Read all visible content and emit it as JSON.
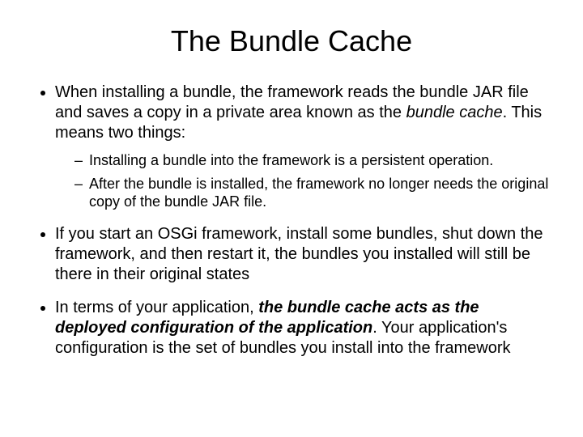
{
  "title": "The Bundle Cache",
  "bullets": {
    "b1_pre": "When installing a bundle, the framework reads the bundle JAR file and saves a copy in a private area known as the ",
    "b1_em": "bundle cache",
    "b1_post": ". This means two things:",
    "b1_sub1": "Installing a bundle into the framework is a persistent operation.",
    "b1_sub2": "After the bundle is installed, the framework no longer needs the original copy of the bundle JAR file.",
    "b2": "If you start an OSGi framework, install some bundles, shut down the framework, and then restart it, the bundles you installed will still be there in their original states",
    "b3_pre": "In terms of your application, ",
    "b3_em": "the bundle cache acts as the deployed configuration of the application",
    "b3_post": ". Your application's configuration is the set of bundles you install into the framework"
  }
}
